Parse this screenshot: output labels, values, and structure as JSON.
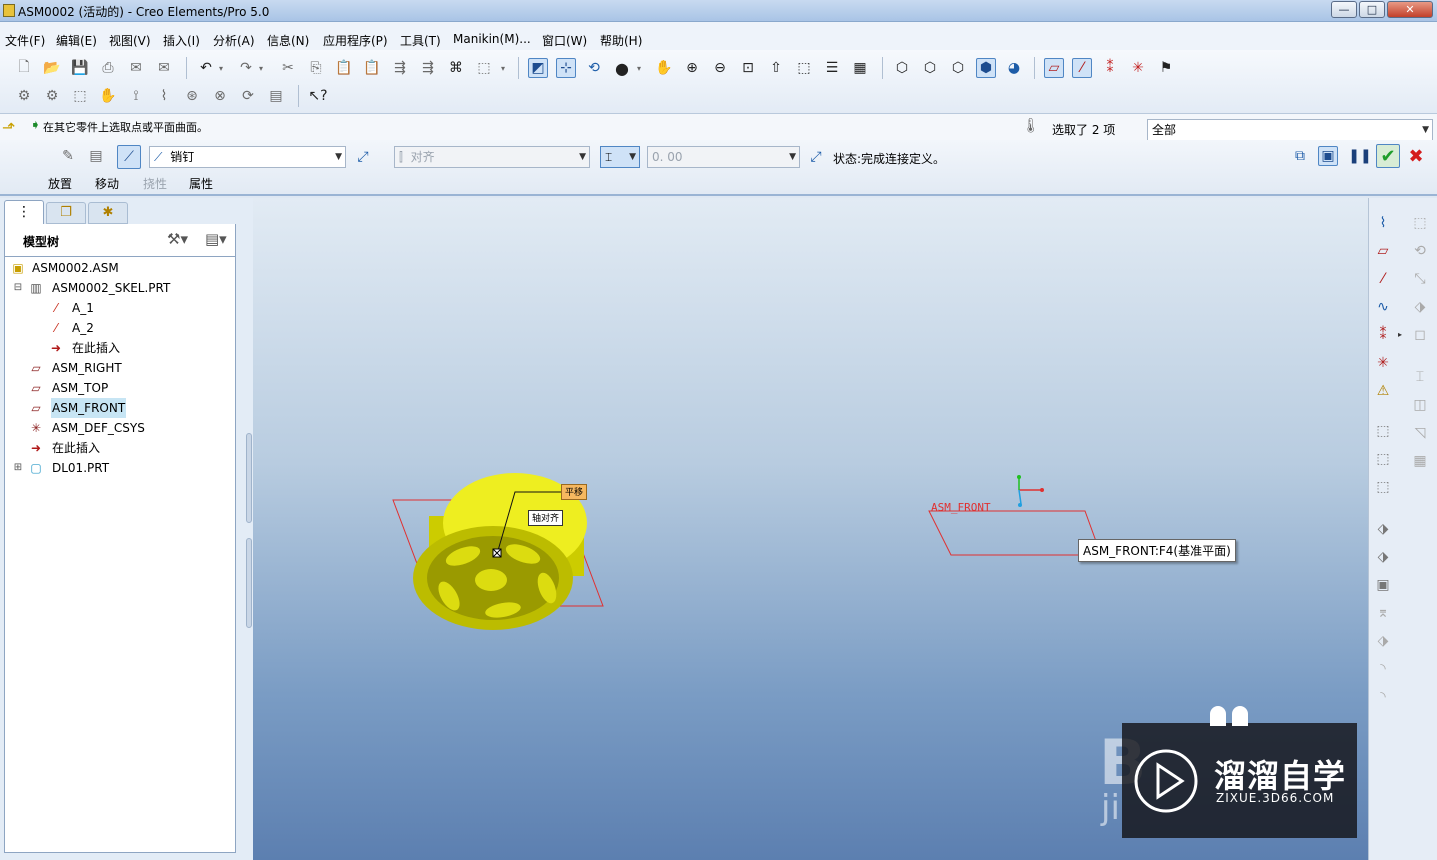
{
  "window": {
    "title": "ASM0002 (活动的) - Creo Elements/Pro 5.0",
    "buttons": {
      "minimize": "—",
      "maximize": "□",
      "close": "✕"
    }
  },
  "menu": [
    "文件(F)",
    "编辑(E)",
    "视图(V)",
    "插入(I)",
    "分析(A)",
    "信息(N)",
    "应用程序(P)",
    "工具(T)",
    "Manikin(M)...",
    "窗口(W)",
    "帮助(H)"
  ],
  "prompt": {
    "message": "在其它零件上选取点或平面曲面。",
    "selection_count": "选取了 2 项",
    "filter_value": "全部"
  },
  "dashboard": {
    "connection_type": "销钉",
    "constraint_type": "对齐",
    "offset_value": "0. 00",
    "status": "状态:完成连接定义。",
    "tabs": [
      {
        "label": "放置",
        "enabled": true
      },
      {
        "label": "移动",
        "enabled": true
      },
      {
        "label": "挠性",
        "enabled": false
      },
      {
        "label": "属性",
        "enabled": true
      }
    ]
  },
  "model_tree": {
    "title": "模型树",
    "items": [
      {
        "label": "ASM0002.ASM",
        "icon": "assembly-icon",
        "indent": 0,
        "expander": ""
      },
      {
        "label": "ASM0002_SKEL.PRT",
        "icon": "skeleton-part-icon",
        "indent": 0,
        "expander": "⊟"
      },
      {
        "label": "A_1",
        "icon": "axis-icon",
        "indent": 2,
        "expander": ""
      },
      {
        "label": "A_2",
        "icon": "axis-icon",
        "indent": 2,
        "expander": ""
      },
      {
        "label": "在此插入",
        "icon": "insert-here-arrow-icon",
        "indent": 2,
        "expander": ""
      },
      {
        "label": "ASM_RIGHT",
        "icon": "datum-plane-icon",
        "indent": 1,
        "expander": ""
      },
      {
        "label": "ASM_TOP",
        "icon": "datum-plane-icon",
        "indent": 1,
        "expander": ""
      },
      {
        "label": "ASM_FRONT",
        "icon": "datum-plane-icon",
        "indent": 1,
        "expander": "",
        "selected": true
      },
      {
        "label": "ASM_DEF_CSYS",
        "icon": "csys-icon",
        "indent": 1,
        "expander": ""
      },
      {
        "label": "在此插入",
        "icon": "insert-here-arrow-icon",
        "indent": 1,
        "expander": ""
      },
      {
        "label": "DL01.PRT",
        "icon": "part-icon",
        "indent": 0,
        "expander": "⊞"
      }
    ]
  },
  "viewport": {
    "plane_label": "ASM_FRONT",
    "tooltip": "ASM_FRONT:F4(基准平面)",
    "callout_1": "平移",
    "callout_2": "轴对齐"
  },
  "watermark": {
    "brand": "溜溜自学",
    "url": "ZIXUE.3D66.COM",
    "background_letters_1": "B",
    "background_letters_2": "ji"
  },
  "colors": {
    "part_yellow": "#e6e600",
    "datum_red": "#e03030",
    "selection_highlight": "#c7e5f4",
    "confirm_green": "#1f9d2b",
    "cancel_red": "#d41c1c"
  }
}
